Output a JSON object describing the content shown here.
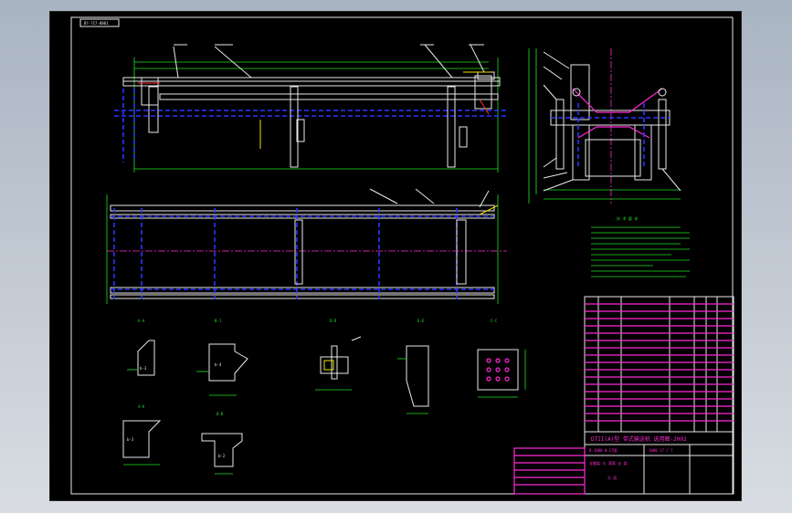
{
  "drawing": {
    "frame_tag": "B?-?17-0001",
    "detail_views": [
      {
        "label": "A-A",
        "area_label": "b-3"
      },
      {
        "label": "B-1",
        "area_label": "b-4"
      },
      {
        "label": "D-D",
        "area_label": ""
      },
      {
        "label": "E-E",
        "area_label": ""
      },
      {
        "label": "C-C",
        "area_label": ""
      },
      {
        "label": "A-K",
        "area_label": "b-3"
      },
      {
        "label": "B-B",
        "area_label": "b-2"
      }
    ],
    "notes_title": "技 术 要 求",
    "title_block": {
      "title_main": "DTII(A)型 带式输送机 选用图-2002",
      "drawing_no": "B-1000 H-17图",
      "sheet_name": "支腿架 与 滚筒 支 架",
      "scale_text": "1000 17 / 7",
      "company": "天 辰"
    }
  },
  "colors": {
    "background": "#000000",
    "outer_desktop": "#bcc4cf",
    "outline": "#e8e8e8",
    "hidden": "#2a35ff",
    "dimension": "#22e022",
    "center": "#ff2bd6",
    "leader": "#f0e000"
  }
}
